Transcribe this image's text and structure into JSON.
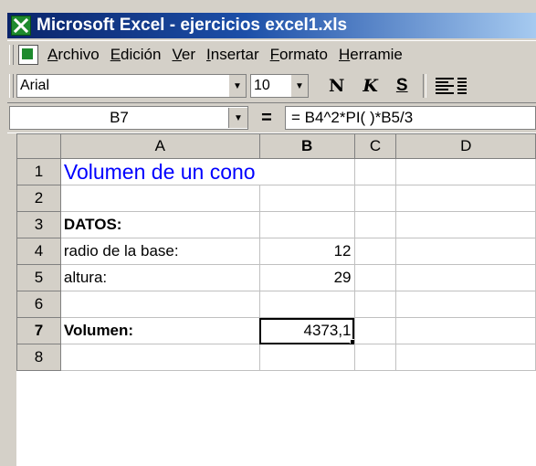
{
  "window": {
    "title": "Microsoft Excel - ejercicios excel1.xls"
  },
  "menu": [
    {
      "key": "A",
      "rest": "rchivo"
    },
    {
      "key": "E",
      "rest": "dición"
    },
    {
      "key": "V",
      "rest": "er"
    },
    {
      "key": "I",
      "rest": "nsertar"
    },
    {
      "key": "F",
      "rest": "ormato"
    },
    {
      "key": "H",
      "rest": "erramie"
    }
  ],
  "toolbar": {
    "font": "Arial",
    "size": "10",
    "bold": "N",
    "italic": "K",
    "underline": "S"
  },
  "formula_bar": {
    "name_box": "B7",
    "equals": "=",
    "formula": "= B4^2*PI( )*B5/3"
  },
  "columns": [
    "A",
    "B",
    "C",
    "D"
  ],
  "rows": [
    {
      "n": "1",
      "a": "Volumen de un cono",
      "b": ""
    },
    {
      "n": "2",
      "a": "",
      "b": ""
    },
    {
      "n": "3",
      "a": "DATOS:",
      "b": ""
    },
    {
      "n": "4",
      "a": "radio de la base:",
      "b": "12"
    },
    {
      "n": "5",
      "a": "altura:",
      "b": "29"
    },
    {
      "n": "6",
      "a": "",
      "b": ""
    },
    {
      "n": "7",
      "a": "Volumen:",
      "b": "4373,1"
    },
    {
      "n": "8",
      "a": "",
      "b": ""
    }
  ]
}
